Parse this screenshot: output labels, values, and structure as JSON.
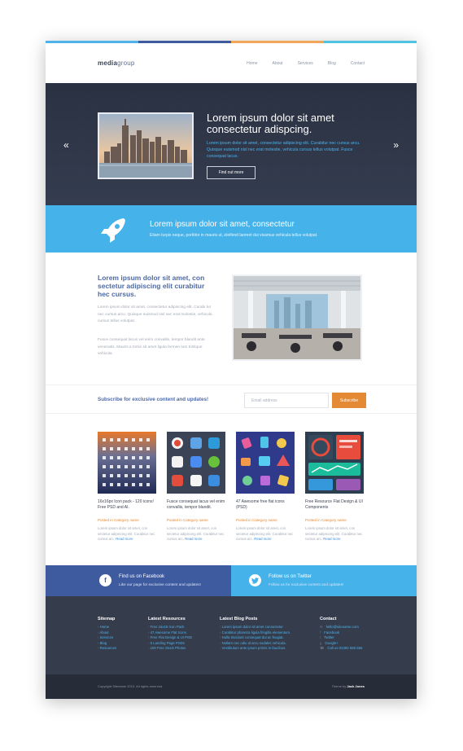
{
  "colors": {
    "bar1": "#4fb2ea",
    "bar2": "#3f5ba0",
    "bar3": "#f2a65a",
    "bar4": "#4fc3e2",
    "accent_blue": "#45b3ea",
    "accent_orange": "#e58a34",
    "dark": "#343c4f"
  },
  "header": {
    "logo_a": "media",
    "logo_b": "group",
    "nav": [
      "Home",
      "About",
      "Services",
      "Blog",
      "Contact"
    ]
  },
  "hero": {
    "prev_icon": "double-chevron-left-icon",
    "next_icon": "double-chevron-right-icon",
    "title": "Lorem ipsum dolor sit amet consectetur adispcing.",
    "text": "Lorem ipsum dolor sit amet, consectetur adipiscing elit. Curabitur nec cursus arcu. Quisque euismod nisl nec erat molestie, vehicula cursus tellus volutpat. Fusce consequat lacus.",
    "button": "Find out more"
  },
  "band": {
    "icon": "rocket-icon",
    "title": "Lorem ipsum dolor sit amet, consectetur",
    "text": "Etiam turpis neque, porttitor in mauris ut, eleifend laoreet dui vivamus vehicula tellus volutpat."
  },
  "about": {
    "title": "Lorem ipsum dolor sit amet, con sectetur adipiscing elit curabitur hec cursus.",
    "p1": "Lorem ipsum dolor sit amet, consectetur adipiscing elit. Curabi tur nec cursus arcu. Quisque euismod nisl nec erat molestie, vehicula cursus tellus volutpat.",
    "p2": "Fusce consequat lacus vel enim convallis, tempor blandit ante venenatis. Mauris a tortor sit amet ligula fermen tum tristique vehicula."
  },
  "subscribe": {
    "label": "Subscribe for exclusive content and updates!",
    "placeholder": "Email address",
    "button": "Subscribe"
  },
  "cards": [
    {
      "title": "16x16px Icon pack - 120 icons! Free PSD and AI.",
      "category": "Posted in Category name",
      "desc": "Lorem ipsum dolor sit amet, con sectetur adipiscing elit. Curabitur nec cursus arc.",
      "more": "Read more"
    },
    {
      "title": "Fusce consequat lacus vel enim convallis, tempor blandit.",
      "category": "Posted in Category name",
      "desc": "Lorem ipsum dolor sit amet, con sectetur adipiscing elit. Curabitur nec cursus arc.",
      "more": "Read more"
    },
    {
      "title": "47 Awesome free flat icons (PSD)",
      "category": "Posted in Category name",
      "desc": "Lorem ipsum dolor sit amet, con sectetur adipiscing elit. Curabitur nec cursus arc.",
      "more": "Read more"
    },
    {
      "title": "Free Resource Flat Design & UI Components",
      "category": "Posted in Category name",
      "desc": "Lorem ipsum dolor sit amet, con sectetur adipiscing elit. Curabitur nec cursus arc.",
      "more": "Read more"
    }
  ],
  "social": {
    "fb_title": "Find us on Facebook",
    "fb_sub": "Like our page for exclusive content and updates!",
    "tw_title": "Follow us on Twitter",
    "tw_sub": "Follow us for exclusive content and updates!"
  },
  "footer": {
    "sitemap_title": "Sitemap",
    "sitemap": [
      "Home",
      "About",
      "Services",
      "Blog",
      "Resources"
    ],
    "resources_title": "Latest Resources",
    "resources": [
      "Free 16x16 Icon Pack",
      "47 Awesome Flat Icons",
      "Free Flat Design & UI PSD",
      "5 Landing Page PSDs",
      "100 Free Stock Photos"
    ],
    "blog_title": "Latest Blog Posts",
    "blog": [
      "Lorem ipsum dolor sit amet consectetur",
      "Curabitur pharetra ligula fringilla elementum.",
      "Nulla tincidunt consequat dui ac feugiat.",
      "Nullam nec odio id arcu sodales vehicula.",
      "Vestibulum ante ipsum primis in faucibus."
    ],
    "contact_title": "Contact",
    "contact": [
      "hello@sitename.com",
      "Facebook",
      "Twitter",
      "Google+",
      "Call us 02392 555 555"
    ]
  },
  "bottom": {
    "copyright": "Copyright Sitename 2013. All rights reserved.",
    "theme_label": "Theme by",
    "theme_author": "Jack Jones"
  }
}
